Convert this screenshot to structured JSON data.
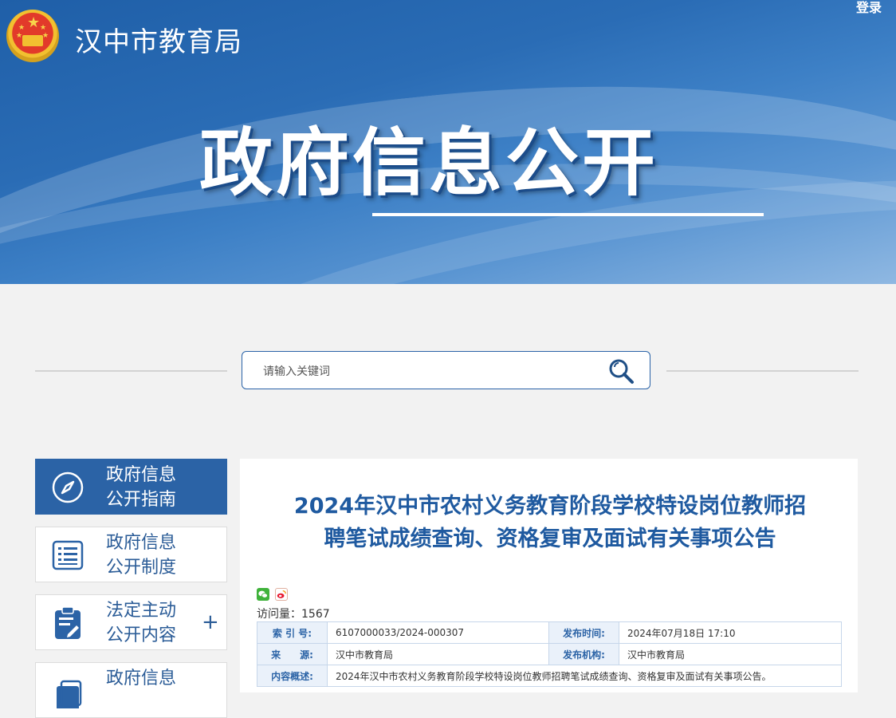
{
  "header": {
    "site_title": "汉中市教育局",
    "login_label": "登录",
    "hero_title": "政府信息公开"
  },
  "search": {
    "placeholder": "请输入关键词",
    "icon": "search-icon"
  },
  "sidebar": {
    "items": [
      {
        "label_line1": "政府信息",
        "label_line2": "公开指南",
        "icon": "compass-icon",
        "active": true
      },
      {
        "label_line1": "政府信息",
        "label_line2": "公开制度",
        "icon": "list-icon",
        "active": false
      },
      {
        "label_line1": "法定主动",
        "label_line2": "公开内容",
        "icon": "clipboard-icon",
        "active": false,
        "expand": "+"
      },
      {
        "label_line1": "政府信息",
        "label_line2": "",
        "icon": "document-icon",
        "active": false
      }
    ]
  },
  "article": {
    "title_line1": "2024年汉中市农村义务教育阶段学校特设岗位教师招",
    "title_line2": "聘笔试成绩查询、资格复审及面试有关事项公告",
    "share": {
      "wechat_icon": "wechat-icon",
      "weibo_icon": "weibo-icon"
    },
    "visits_label": "访问量：",
    "visits_value": "1567",
    "meta": {
      "index_label": "索 引 号:",
      "index_value": "6107000033/2024-000307",
      "publish_time_label": "发布时间:",
      "publish_time_value": "2024年07月18日 17:10",
      "source_label": "来　　源:",
      "source_value": "汉中市教育局",
      "publisher_label": "发布机构:",
      "publisher_value": "汉中市教育局",
      "summary_label": "内容概述:",
      "summary_value": "2024年汉中市农村义务教育阶段学校特设岗位教师招聘笔试成绩查询、资格复审及面试有关事项公告。"
    }
  },
  "colors": {
    "brand_blue": "#2b63a6",
    "title_blue": "#1f5aa0",
    "panel_bg": "#f2f2f2"
  }
}
